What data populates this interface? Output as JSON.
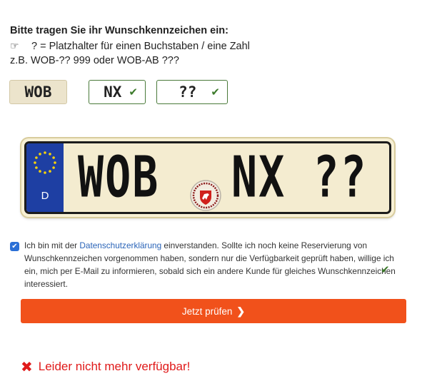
{
  "intro": {
    "heading": "Bitte tragen Sie ihr Wunschkennzeichen ein:",
    "hint_icon": "☞",
    "hint_text": "? = Platzhalter für einen Buchstaben / eine Zahl",
    "example": "z.B. WOB-?? 999 oder WOB-AB ???"
  },
  "fields": {
    "city": "WOB",
    "letters": "NX",
    "numbers": "??",
    "check_glyph": "✔"
  },
  "plate": {
    "country": "D",
    "city": "WOB",
    "rest": "NX ??",
    "icons": {
      "eu": "eu-stars-icon",
      "seal": "state-seal-icon"
    }
  },
  "consent": {
    "checked": true,
    "check_glyph": "✔",
    "before_link": "Ich bin mit der ",
    "link": "Datenschutzerklärung",
    "after_link": " einverstanden. Sollte ich noch keine Reservierung von Wunschkennzeichen vorgenommen haben, sondern nur die Verfügbarkeit geprüft haben, willige ich ein, mich per E-Mail zu informieren, sobald sich ein andere Kunde für gleiches Wunschkennzeichen interessiert."
  },
  "submit": {
    "label": "Jetzt prüfen",
    "chevron": "❯"
  },
  "result": {
    "icon": "✖",
    "text": "Leider nicht mehr verfügbar!"
  },
  "colors": {
    "accent": "#f1511b",
    "error": "#e01a1a",
    "valid": "#3c7a2b",
    "eu_blue": "#1e3fa3"
  }
}
